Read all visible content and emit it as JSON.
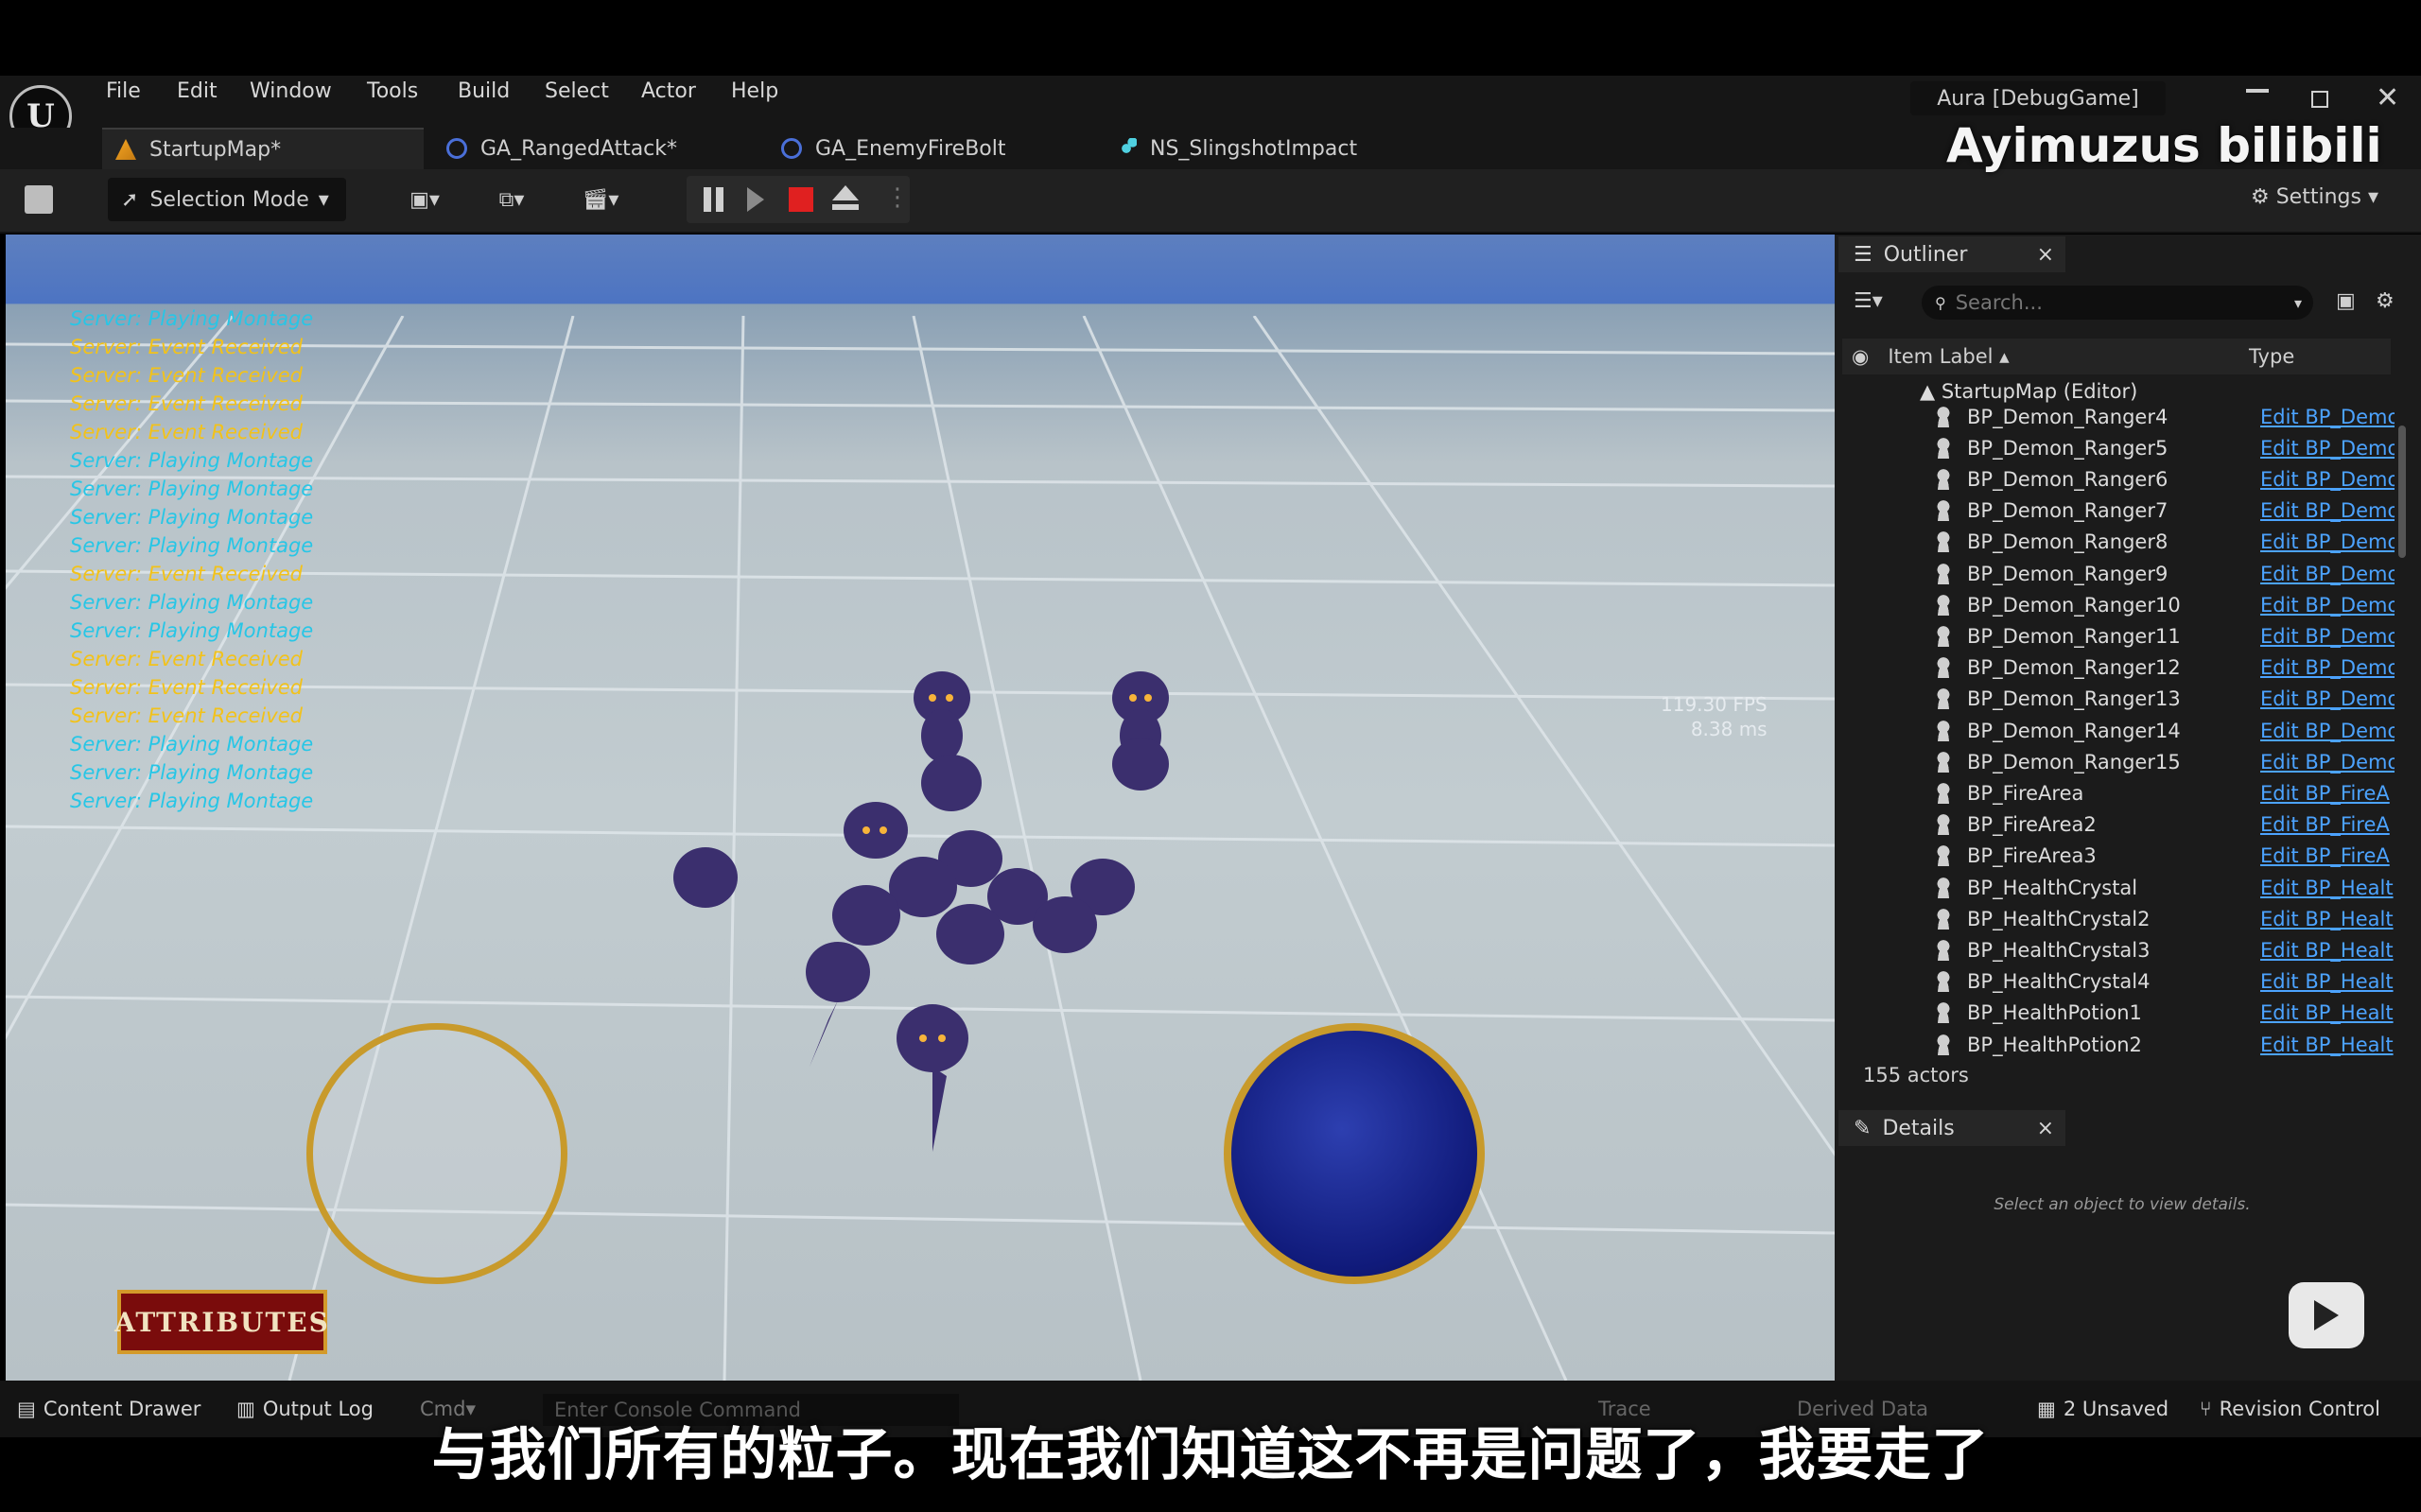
{
  "menu": [
    "File",
    "Edit",
    "Window",
    "Tools",
    "Build",
    "Select",
    "Actor",
    "Help"
  ],
  "window_title": "Aura [DebugGame]",
  "tabs": [
    {
      "label": "StartupMap*",
      "icon": "map-icon",
      "active": true
    },
    {
      "label": "GA_RangedAttack*",
      "icon": "blueprint-icon"
    },
    {
      "label": "GA_EnemyFireBolt",
      "icon": "blueprint-icon"
    },
    {
      "label": "NS_SlingshotImpact",
      "icon": "niagara-icon"
    }
  ],
  "toolbar": {
    "selection_mode": "Selection Mode",
    "settings": "Settings"
  },
  "viewport": {
    "messages": [
      {
        "text": "Server: Playing Montage",
        "color": "#27c6e6"
      },
      {
        "text": "Server: Event Received",
        "color": "#f2c21a"
      },
      {
        "text": "Server: Event Received",
        "color": "#f2c21a"
      },
      {
        "text": "Server: Event Received",
        "color": "#f2c21a"
      },
      {
        "text": "Server: Event Received",
        "color": "#f2c21a"
      },
      {
        "text": "Server: Playing Montage",
        "color": "#27c6e6"
      },
      {
        "text": "Server: Playing Montage",
        "color": "#27c6e6"
      },
      {
        "text": "Server: Playing Montage",
        "color": "#27c6e6"
      },
      {
        "text": "Server: Playing Montage",
        "color": "#27c6e6"
      },
      {
        "text": "Server: Event Received",
        "color": "#f2c21a"
      },
      {
        "text": "Server: Playing Montage",
        "color": "#27c6e6"
      },
      {
        "text": "Server: Playing Montage",
        "color": "#27c6e6"
      },
      {
        "text": "Server: Event Received",
        "color": "#f2c21a"
      },
      {
        "text": "Server: Event Received",
        "color": "#f2c21a"
      },
      {
        "text": "Server: Event Received",
        "color": "#f2c21a"
      },
      {
        "text": "Server: Playing Montage",
        "color": "#27c6e6"
      },
      {
        "text": "Server: Playing Montage",
        "color": "#27c6e6"
      },
      {
        "text": "Server: Playing Montage",
        "color": "#27c6e6"
      }
    ],
    "fps": "119.30 FPS",
    "ms": "8.38 ms",
    "attributes_button": "ATTRIBUTES"
  },
  "outliner": {
    "title": "Outliner",
    "search_placeholder": "Search...",
    "col_label": "Item Label ▴",
    "col_type": "Type",
    "root": "StartupMap (Editor)",
    "items": [
      {
        "label": "BP_Demon_Ranger4",
        "type": "Edit BP_Demo"
      },
      {
        "label": "BP_Demon_Ranger5",
        "type": "Edit BP_Demo"
      },
      {
        "label": "BP_Demon_Ranger6",
        "type": "Edit BP_Demo"
      },
      {
        "label": "BP_Demon_Ranger7",
        "type": "Edit BP_Demo"
      },
      {
        "label": "BP_Demon_Ranger8",
        "type": "Edit BP_Demo"
      },
      {
        "label": "BP_Demon_Ranger9",
        "type": "Edit BP_Demo"
      },
      {
        "label": "BP_Demon_Ranger10",
        "type": "Edit BP_Demo"
      },
      {
        "label": "BP_Demon_Ranger11",
        "type": "Edit BP_Demo"
      },
      {
        "label": "BP_Demon_Ranger12",
        "type": "Edit BP_Demo"
      },
      {
        "label": "BP_Demon_Ranger13",
        "type": "Edit BP_Demo"
      },
      {
        "label": "BP_Demon_Ranger14",
        "type": "Edit BP_Demo"
      },
      {
        "label": "BP_Demon_Ranger15",
        "type": "Edit BP_Demo"
      },
      {
        "label": "BP_FireArea",
        "type": "Edit BP_FireA"
      },
      {
        "label": "BP_FireArea2",
        "type": "Edit BP_FireA"
      },
      {
        "label": "BP_FireArea3",
        "type": "Edit BP_FireA"
      },
      {
        "label": "BP_HealthCrystal",
        "type": "Edit BP_Healt"
      },
      {
        "label": "BP_HealthCrystal2",
        "type": "Edit BP_Healt"
      },
      {
        "label": "BP_HealthCrystal3",
        "type": "Edit BP_Healt"
      },
      {
        "label": "BP_HealthCrystal4",
        "type": "Edit BP_Healt"
      },
      {
        "label": "BP_HealthPotion1",
        "type": "Edit BP_Healt"
      },
      {
        "label": "BP_HealthPotion2",
        "type": "Edit BP_Healt"
      }
    ],
    "count": "155 actors"
  },
  "details": {
    "title": "Details",
    "empty": "Select an object to view details."
  },
  "statusbar": {
    "content_drawer": "Content Drawer",
    "output_log": "Output Log",
    "cmd": "Cmd",
    "console_placeholder": "Enter Console Command",
    "trace": "Trace",
    "derived_data": "Derived Data",
    "unsaved": "2 Unsaved",
    "revision": "Revision Control"
  },
  "watermark": "Ayimuzus bilibili",
  "subtitle": "与我们所有的粒子。现在我们知道这不再是问题了，我要走了"
}
